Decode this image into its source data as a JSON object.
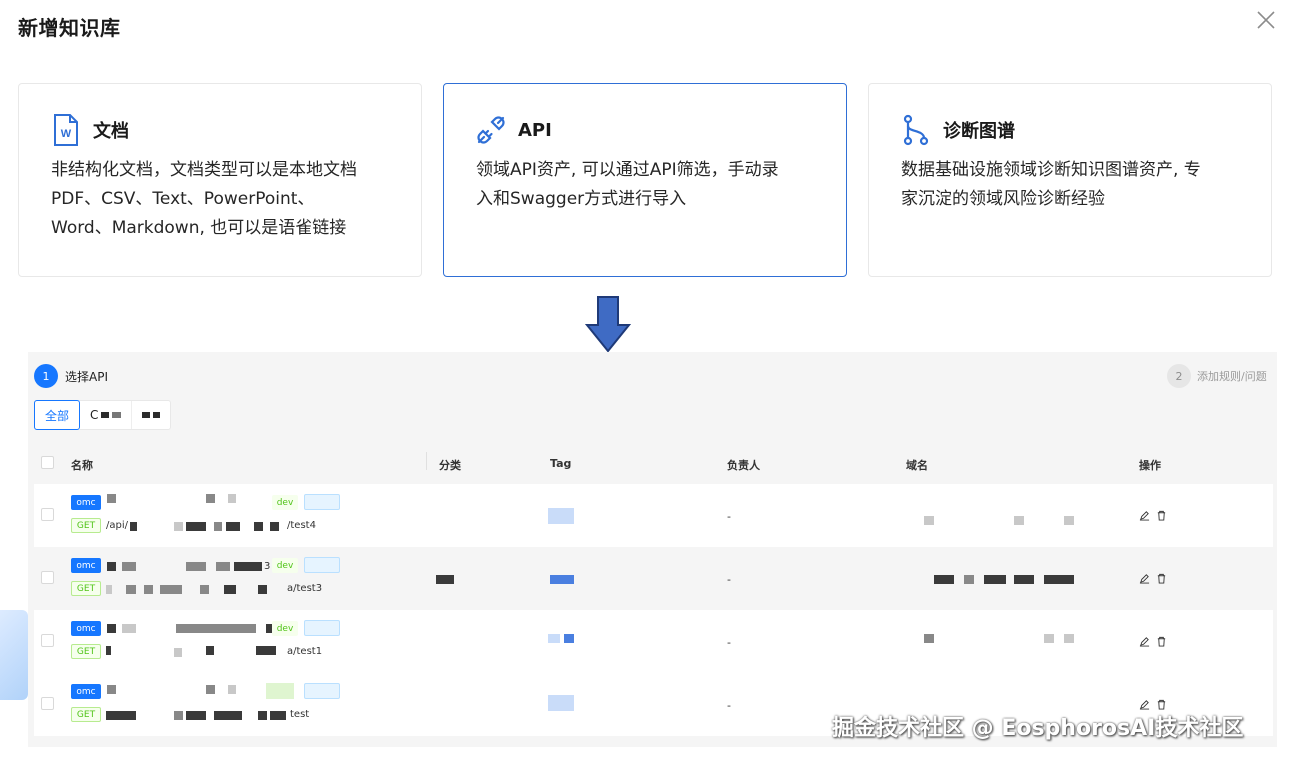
{
  "modal": {
    "title": "新增知识库"
  },
  "cards": [
    {
      "title": "文档",
      "icon": "word-document-icon",
      "desc": [
        "非结构化文档，文档类型可以是本地文档",
        "PDF、CSV、Text、PowerPoint、",
        "Word、Markdown, 也可以是语雀链接"
      ]
    },
    {
      "title": "API",
      "icon": "api-plug-icon",
      "desc": [
        "领域API资产, 可以通过API筛选，手动录",
        "入和Swagger方式进行导入"
      ]
    },
    {
      "title": "诊断图谱",
      "icon": "branch-graph-icon",
      "desc": [
        "数据基础设施领域诊断知识图谱资产, 专",
        "家沉淀的领域风险诊断经验"
      ]
    }
  ],
  "steps": [
    {
      "num": "1",
      "label": "选择API"
    },
    {
      "num": "2",
      "label": "添加规则/问题"
    }
  ],
  "segments": {
    "all": "全部",
    "second_initial": "C"
  },
  "table": {
    "headers": [
      "名称",
      "分类",
      "Tag",
      "负责人",
      "域名",
      "操作"
    ],
    "rows": [
      {
        "omc": "omc",
        "method": "GET",
        "path_prefix": "/api/",
        "path_suffix": "/test4",
        "dev": "dev",
        "mid_char": "",
        "owner": "-"
      },
      {
        "omc": "omc",
        "method": "GET",
        "path_prefix": "",
        "path_suffix": "a/test3",
        "dev": "dev",
        "mid_char": "3",
        "owner": "-"
      },
      {
        "omc": "omc",
        "method": "GET",
        "path_prefix": "",
        "path_suffix": "a/test1",
        "dev": "dev",
        "mid_char": "",
        "owner": "-"
      },
      {
        "omc": "omc",
        "method": "GET",
        "path_prefix": "",
        "path_suffix": "test",
        "dev": "",
        "mid_char": "",
        "owner": "-"
      }
    ]
  },
  "colors": {
    "primary": "#1677ff",
    "card_selected_border": "#2f6fd6",
    "arrow_fill": "#3f6bc4"
  },
  "watermark": "掘金技术社区 @ EosphorosAI技术社区"
}
